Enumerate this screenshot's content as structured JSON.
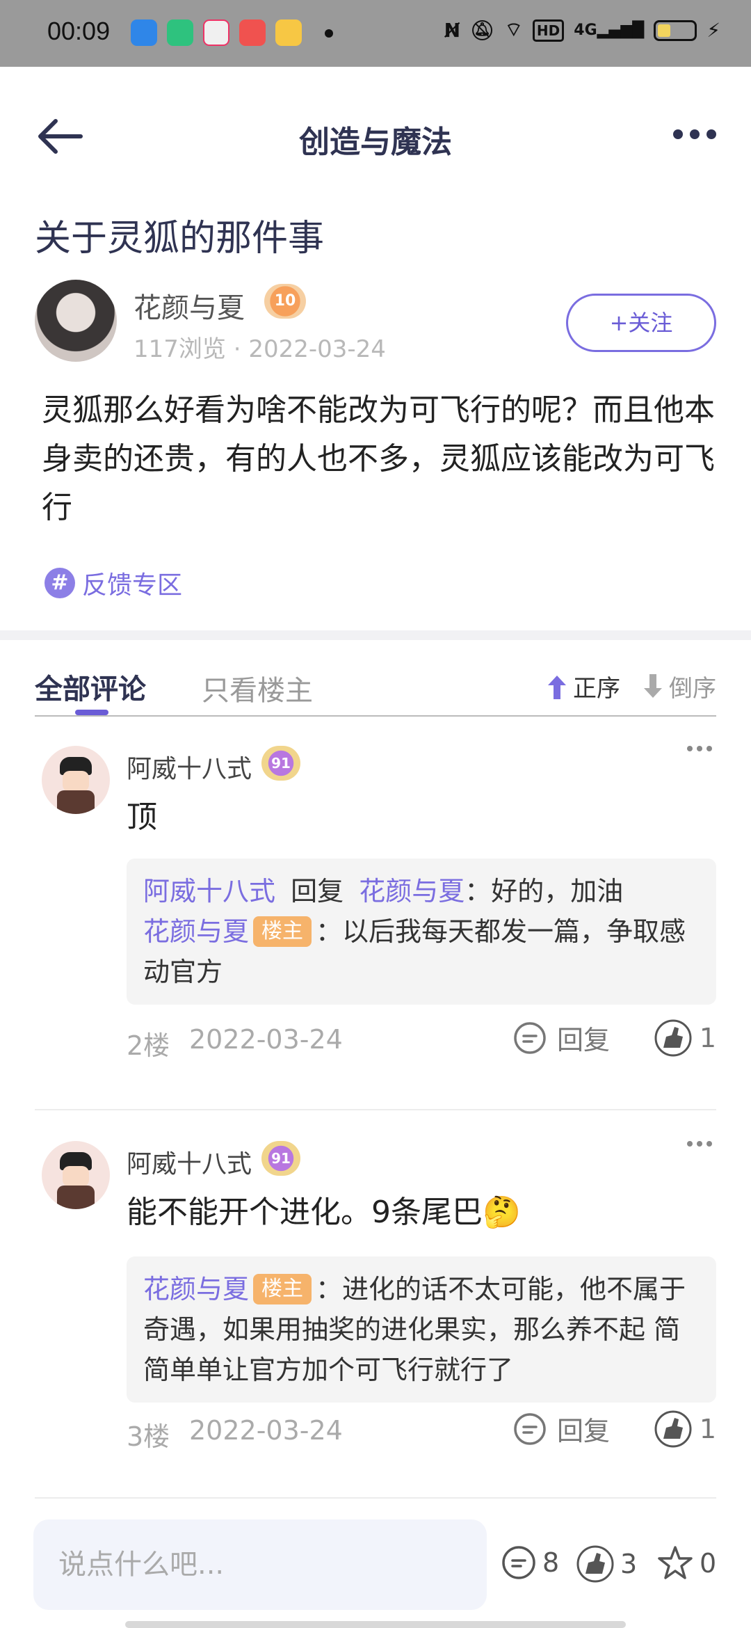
{
  "status_bar": {
    "time": "00:09",
    "network": "4G",
    "hd": "HD",
    "app_icons": [
      "blue-app",
      "green-app",
      "game-app",
      "music-app",
      "weibo-app"
    ]
  },
  "nav": {
    "title": "创造与魔法"
  },
  "post": {
    "title": "关于灵狐的那件事",
    "author": "花颜与夏",
    "author_level": "10",
    "meta": "117浏览 · 2022-03-24",
    "follow_label": "+关注",
    "body": "灵狐那么好看为啥不能改为可飞行的呢？而且他本身卖的还贵，有的人也不多，灵狐应该能改为可飞行",
    "topic": "反馈专区",
    "topic_icon": "#"
  },
  "tabs": {
    "all": "全部评论",
    "owner_only": "只看楼主",
    "sort_asc": "正序",
    "sort_desc": "倒序"
  },
  "comments": [
    {
      "author": "阿威十八式",
      "level": "91",
      "text": "顶",
      "replies": [
        {
          "from": "阿威十八式",
          "verb": "回复",
          "to": "花颜与夏",
          "colon": "：",
          "text": "好的，加油"
        },
        {
          "from": "花颜与夏",
          "tag": "楼主",
          "colon": "：",
          "text": "以后我每天都发一篇，争取感动官方"
        }
      ],
      "floor": "2楼",
      "date": "2022-03-24",
      "reply_label": "回复",
      "likes": "1"
    },
    {
      "author": "阿威十八式",
      "level": "91",
      "text": "能不能开个进化。9条尾巴🤔",
      "replies": [
        {
          "from": "花颜与夏",
          "tag": "楼主",
          "colon": "：",
          "text": "进化的话不太可能，他不属于奇遇，如果用抽奖的进化果实，那么养不起 简简单单让官方加个可飞行就行了"
        }
      ],
      "floor": "3楼",
      "date": "2022-03-24",
      "reply_label": "回复",
      "likes": "1"
    }
  ],
  "bottom": {
    "input_placeholder": "说点什么吧...",
    "comment_count": "8",
    "like_count": "3",
    "star_count": "0"
  },
  "colors": {
    "accent": "#6a5cd6",
    "owner_tag": "#f6b36b",
    "title_text": "#2f3352"
  }
}
